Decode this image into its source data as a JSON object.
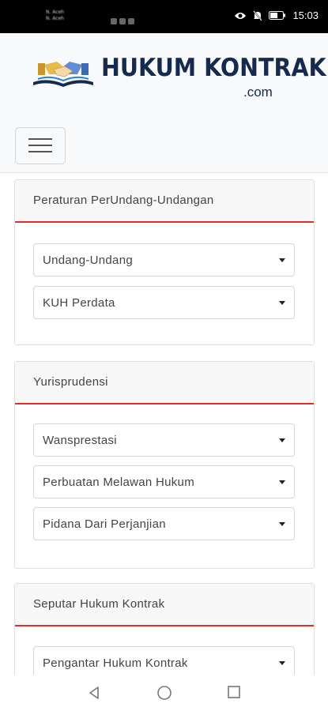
{
  "status_bar": {
    "notifications": [
      "N. Aceh",
      "N. Aceh"
    ],
    "time": "15:03",
    "icons": [
      "eye-icon",
      "mute-icon",
      "battery-icon"
    ]
  },
  "header": {
    "logo_title": "HUKUM KONTRAK",
    "logo_subtitle": ".com",
    "menu_icon": "hamburger-icon"
  },
  "sections": [
    {
      "title": "Peraturan PerUndang-Undangan",
      "items": [
        "Undang-Undang",
        "KUH Perdata"
      ]
    },
    {
      "title": "Yurisprudensi",
      "items": [
        "Wansprestasi",
        "Perbuatan Melawan Hukum",
        "Pidana Dari Perjanjian"
      ]
    },
    {
      "title": "Seputar Hukum Kontrak",
      "items": [
        "Pengantar Hukum Kontrak"
      ]
    }
  ],
  "nav": {
    "icons": [
      "back-icon",
      "home-icon",
      "recents-icon"
    ]
  },
  "colors": {
    "accent": "#e52b2b",
    "brand": "#152a4d",
    "header_bg": "#f8f9fa"
  }
}
